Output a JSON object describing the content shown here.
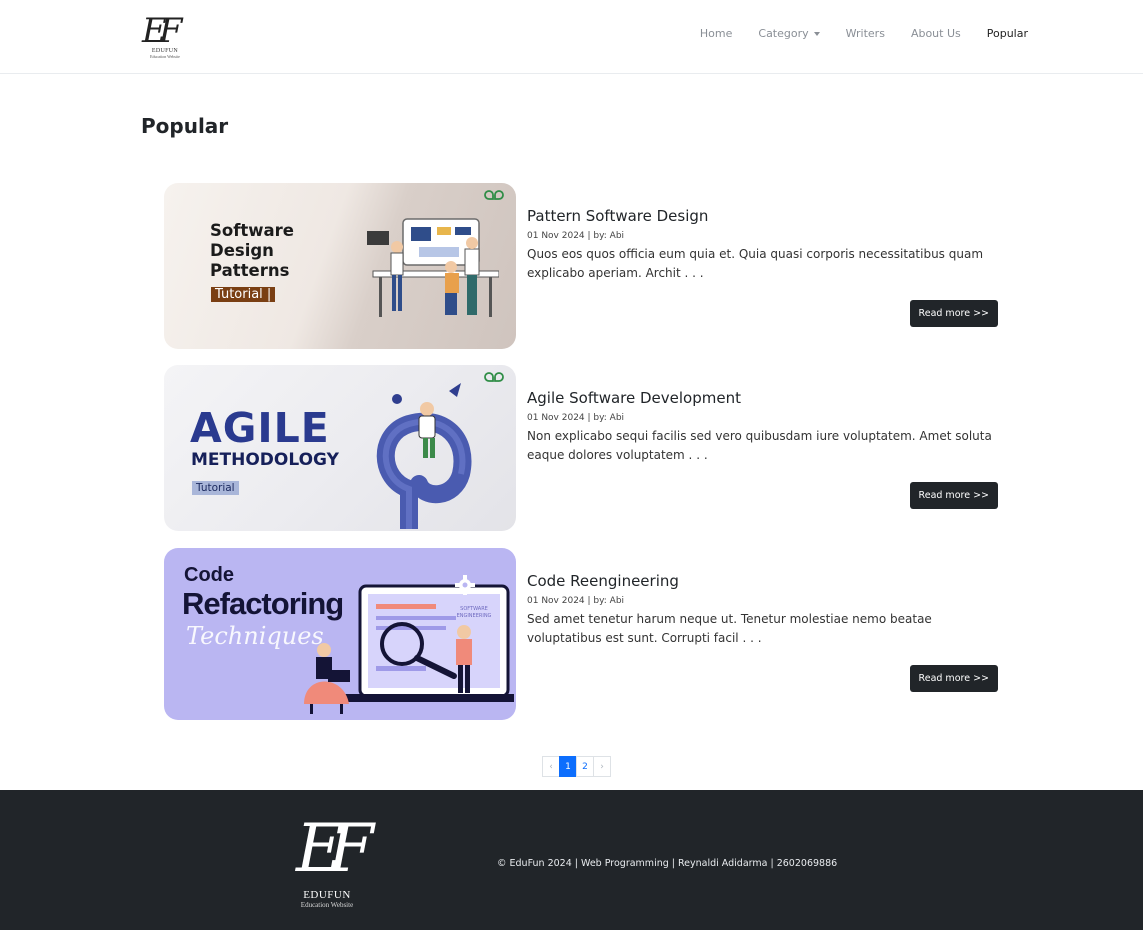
{
  "brand": {
    "mark": "EF",
    "name": "EDUFUN",
    "subtitle": "Education Website"
  },
  "nav": {
    "items": [
      {
        "label": "Home"
      },
      {
        "label": "Category"
      },
      {
        "label": "Writers"
      },
      {
        "label": "About Us"
      },
      {
        "label": "Popular"
      }
    ],
    "active": "Popular"
  },
  "page_title": "Popular",
  "posts": [
    {
      "title": "Pattern Software Design",
      "meta": "01 Nov 2024 | by: Abi",
      "excerpt": "Quos eos quos officia eum quia et. Quia quasi corporis necessitatibus quam explicabo aperiam. Archit . . .",
      "button": "Read more >>",
      "thumb": {
        "lines": [
          "Software",
          "Design",
          "Patterns"
        ],
        "tag": "Tutorial |",
        "badge": "GfG"
      }
    },
    {
      "title": "Agile Software Development",
      "meta": "01 Nov 2024 | by: Abi",
      "excerpt": "Non explicabo sequi facilis sed vero quibusdam iure voluptatem. Amet soluta eaque dolores voluptatem . . .",
      "button": "Read more >>",
      "thumb": {
        "big": "AGILE",
        "sub": "METHODOLOGY",
        "tag": "Tutorial",
        "badge": "GfG"
      }
    },
    {
      "title": "Code Reengineering",
      "meta": "01 Nov 2024 | by: Abi",
      "excerpt": "Sed amet tenetur harum neque ut. Tenetur molestiae nemo beatae voluptatibus est sunt. Corrupti facil . . .",
      "button": "Read more >>",
      "thumb": {
        "line1": "Code",
        "line2": "Refactoring",
        "line3": "Techniques",
        "screen_label": "SOFTWARE ENGINEERING"
      }
    }
  ],
  "pagination": {
    "prev": "‹",
    "pages": [
      "1",
      "2"
    ],
    "current": "1",
    "next": "›"
  },
  "footer": {
    "mark": "EF",
    "name": "EDUFUN",
    "subtitle": "Education Website",
    "copyright": "© EduFun 2024 | Web Programming | Reynaldi Adidarma | 2602069886"
  },
  "colors": {
    "footer_bg": "#212529",
    "button_bg": "#212529",
    "accent": "#0d6efd",
    "gfg_green": "#2f8d46"
  }
}
